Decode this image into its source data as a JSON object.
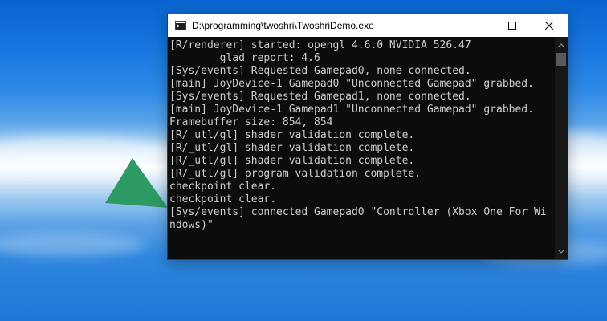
{
  "window": {
    "title": "D:\\programming\\twoshri\\TwoshriDemo.exe",
    "app_icon": "console-app-icon",
    "controls": {
      "minimize": "minimize-icon",
      "maximize": "maximize-icon",
      "close": "close-icon"
    }
  },
  "console": {
    "lines": [
      "[R/renderer] started: opengl 4.6.0 NVIDIA 526.47",
      "        glad report: 4.6",
      "[Sys/events] Requested Gamepad0, none connected.",
      "[main] JoyDevice-1 Gamepad0 \"Unconnected Gamepad\" grabbed.",
      "[Sys/events] Requested Gamepad1, none connected.",
      "[main] JoyDevice-1 Gamepad1 \"Unconnected Gamepad\" grabbed.",
      "Framebuffer size: 854, 854",
      "[R/_utl/gl] shader validation complete.",
      "[R/_utl/gl] shader validation complete.",
      "[R/_utl/gl] shader validation complete.",
      "[R/_utl/gl] program validation complete.",
      "checkpoint clear.",
      "checkpoint clear.",
      "[Sys/events] connected Gamepad0 \"Controller (Xbox One For Wi",
      "ndows)\""
    ],
    "text_color": "#cccccc",
    "background": "#0c0c0c"
  },
  "scrollbar": {
    "up": "scroll-up-icon",
    "down": "scroll-down-icon"
  },
  "scene": {
    "shape": "green-triangle",
    "triangle_color": "#2e9a63"
  }
}
